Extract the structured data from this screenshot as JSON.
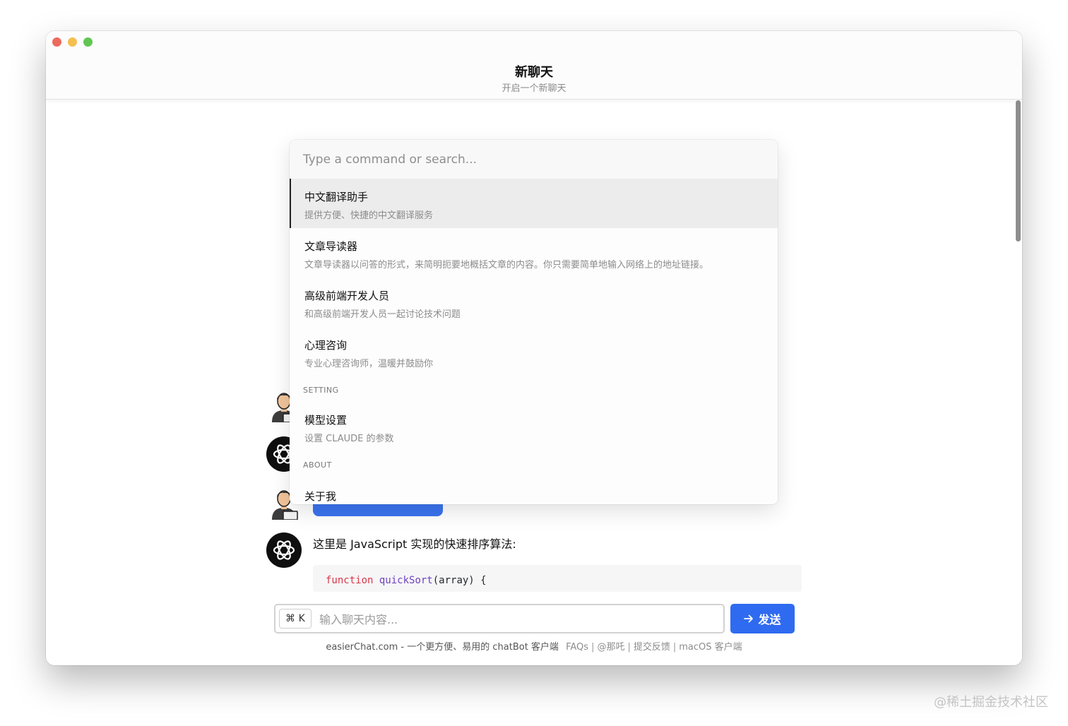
{
  "window": {
    "title": "新聊天",
    "subtitle": "开启一个新聊天"
  },
  "palette": {
    "placeholder": "Type a command or search...",
    "items": [
      {
        "title": "中文翻译助手",
        "desc": "提供方便、快捷的中文翻译服务"
      },
      {
        "title": "文章导读器",
        "desc": "文章导读器以问答的形式，来简明扼要地概括文章的内容。你只需要简单地输入网络上的地址链接。"
      },
      {
        "title": "高级前端开发人员",
        "desc": "和高级前端开发人员一起讨论技术问题"
      },
      {
        "title": "心理咨询",
        "desc": "专业心理咨询师，温暖并鼓励你"
      }
    ],
    "setting_group": "SETTING",
    "setting_items": [
      {
        "title": "模型设置",
        "desc": "设置 CLAUDE 的参数"
      }
    ],
    "about_group": "ABOUT",
    "about_items": [
      {
        "title": "关于我"
      }
    ]
  },
  "chat": {
    "bot_reply": "这里是 JavaScript 实现的快速排序算法:",
    "code": {
      "keyword": "function",
      "name": "quickSort",
      "rest": "(array) {"
    }
  },
  "input": {
    "shortcut": "⌘ K",
    "placeholder": "输入聊天内容...",
    "send_label": "发送"
  },
  "footer": {
    "brand": "easierChat.com - 一个更方便、易用的 chatBot 客户端",
    "links": [
      "FAQs",
      "@那吒",
      "提交反馈",
      "macOS 客户端"
    ]
  },
  "watermark": "@稀土掘金技术社区",
  "colors": {
    "accent": "#2f6bf0",
    "traffic_red": "#ed6a5e",
    "traffic_yellow": "#f5bf4f",
    "traffic_green": "#61c554"
  }
}
